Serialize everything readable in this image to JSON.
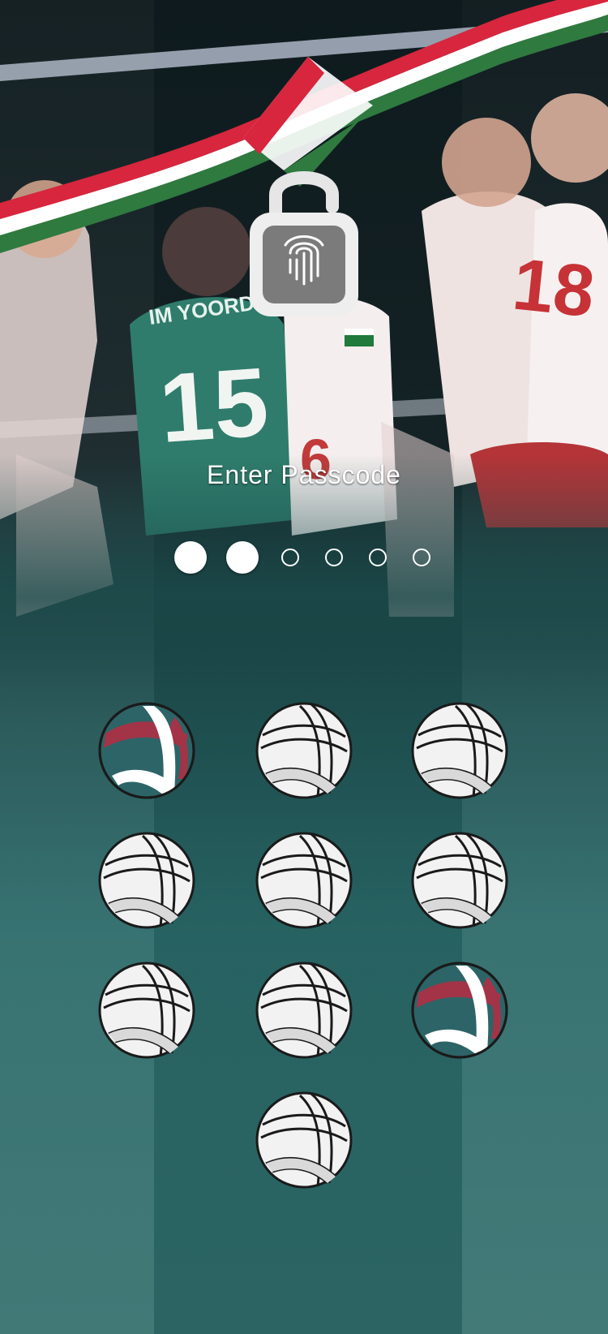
{
  "lock_screen": {
    "title": "Enter Passcode",
    "lock_icon": "open-padlock-fingerprint-icon",
    "passcode": {
      "length": 6,
      "entered": 2
    },
    "keypad": {
      "keys": [
        {
          "style": "colored",
          "icon": "volleyball-icon"
        },
        {
          "style": "white",
          "icon": "volleyball-icon"
        },
        {
          "style": "white",
          "icon": "volleyball-icon"
        },
        {
          "style": "white",
          "icon": "volleyball-icon"
        },
        {
          "style": "white",
          "icon": "volleyball-icon"
        },
        {
          "style": "white",
          "icon": "volleyball-icon"
        },
        {
          "style": "white",
          "icon": "volleyball-icon"
        },
        {
          "style": "white",
          "icon": "volleyball-icon"
        },
        {
          "style": "colored",
          "icon": "volleyball-icon"
        },
        {
          "style": "white",
          "icon": "volleyball-icon"
        }
      ]
    },
    "background": {
      "jersey_numbers": [
        "15",
        "18",
        "6"
      ],
      "jersey_name": "IM YOORDVA"
    },
    "colors": {
      "teal": "#2f6d6c",
      "ribbon_red": "#d7263d",
      "ribbon_white": "#ffffff",
      "ribbon_green": "#2f7a3f",
      "ball_red": "#a33447",
      "ball_teal": "#2d6467"
    }
  }
}
